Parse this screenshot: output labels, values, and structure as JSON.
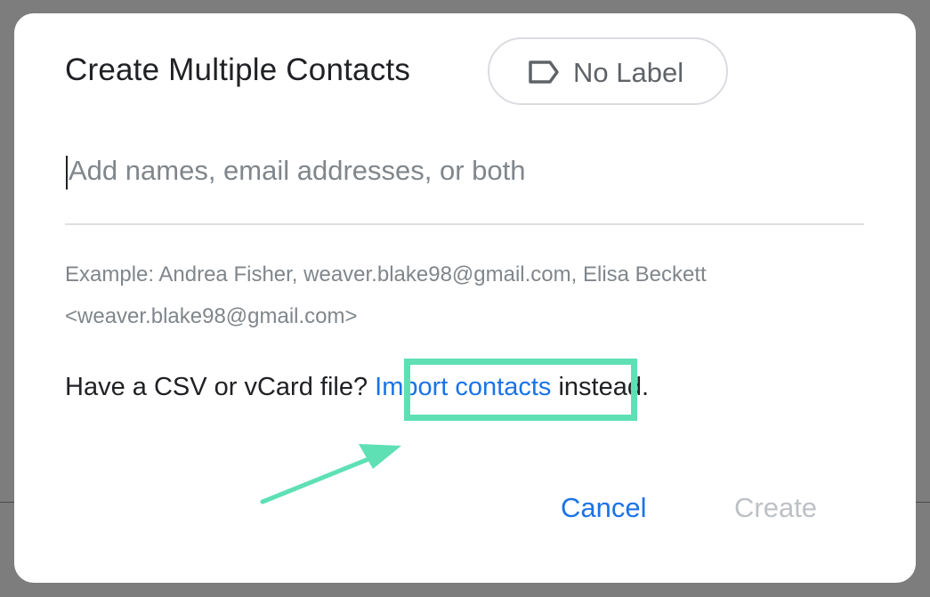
{
  "dialog": {
    "title": "Create Multiple Contacts",
    "label_chip": {
      "icon": "label-tag-icon",
      "text": "No Label"
    },
    "input": {
      "value": "",
      "placeholder": "Add names, email addresses, or both"
    },
    "example_text": "Example: Andrea Fisher, weaver.blake98@gmail.com, Elisa Beckett <weaver.blake98@gmail.com>",
    "import_prompt": {
      "before": "Have a CSV or vCard file?",
      "link": "Import contacts",
      "after": "instead."
    },
    "actions": {
      "cancel_label": "Cancel",
      "create_label": "Create"
    }
  },
  "annotation": {
    "highlight_color": "#5ee0b4",
    "arrow_icon": "pointer-arrow-icon"
  },
  "colors": {
    "accent": "#1a73e8",
    "disabled": "#bdc1c6",
    "overlay": "#7d7d7d"
  }
}
